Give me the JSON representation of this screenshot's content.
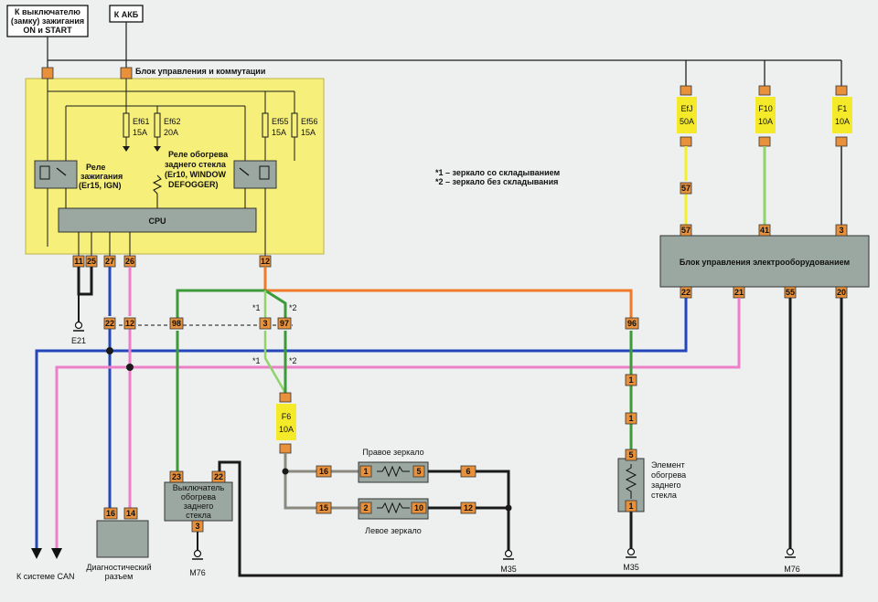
{
  "top_labels": {
    "ignition_switch": [
      "К выключателю",
      "(замку) зажигания",
      "ON и START"
    ],
    "battery": "К АКБ"
  },
  "control_unit": {
    "title": "Блок управления и коммутации",
    "cpu": "CPU",
    "ignition_relay": [
      "Реле",
      "зажигания",
      "(Er15, IGN)"
    ],
    "defogger_relay": [
      "Реле обогрева",
      "заднего стекла",
      "(Er10, WINDOW",
      "DEFOGGER)"
    ],
    "fuses": [
      {
        "name": "Ef61",
        "rating": "15A"
      },
      {
        "name": "Ef62",
        "rating": "20A"
      },
      {
        "name": "Ef55",
        "rating": "15A"
      },
      {
        "name": "Ef56",
        "rating": "15A"
      }
    ],
    "bottom_pins": [
      "11",
      "25",
      "27",
      "26",
      "12"
    ]
  },
  "notes": [
    "*1 – зеркало со складыванием",
    "*2 – зеркало без складывания"
  ],
  "right_fuses": [
    {
      "name": "EfJ",
      "rating": "50A"
    },
    {
      "name": "F10",
      "rating": "10A"
    },
    {
      "name": "F1",
      "rating": "10A"
    }
  ],
  "body_control": {
    "title": "Блок управления электрооборудованием",
    "top_pins": [
      "57",
      "41",
      "3"
    ],
    "bottom_pins": [
      "22",
      "21",
      "55",
      "20"
    ]
  },
  "connectors": {
    "c57": "57",
    "c22": "22",
    "c12": "12",
    "c98": "98",
    "c3": "3",
    "c97": "97",
    "c96": "96",
    "c1a": "1",
    "c1b": "1",
    "c5": "5",
    "c1c": "1",
    "c16": "16",
    "c15": "15",
    "c1d": "1",
    "c5b": "5",
    "c2": "2",
    "c10": "10",
    "c6": "6",
    "c12b": "12",
    "c23": "23",
    "c22b": "22",
    "c3b": "3",
    "c16b": "16",
    "c14": "14"
  },
  "fuse_f6": {
    "name": "F6",
    "rating": "10A"
  },
  "star_marks": {
    "s1a": "*1",
    "s2a": "*2",
    "s1b": "*1",
    "s2b": "*2"
  },
  "components": {
    "right_mirror": "Правое зеркало",
    "left_mirror": "Левое зеркало",
    "rear_heater": [
      "Элемент",
      "обогрева",
      "заднего",
      "стекла"
    ],
    "defogger_switch": [
      "Выключатель",
      "обогрева",
      "заднего",
      "стекла"
    ],
    "diag_connector": [
      "Диагностический",
      "разъем"
    ]
  },
  "grounds": {
    "e21": "E21",
    "m76a": "M76",
    "m35a": "M35",
    "m35b": "M35",
    "m76b": "M76"
  },
  "can_label": "К системе CAN",
  "wire_colors": {
    "orange": "#f07a2a",
    "green": "#3d9a3a",
    "lightgreen": "#8fd36a",
    "blue": "#2346b8",
    "pink": "#ec7fc8",
    "black": "#1a1a1a",
    "yellow": "#f2f02a",
    "gray": "#8a8a80",
    "dark": "#222"
  }
}
